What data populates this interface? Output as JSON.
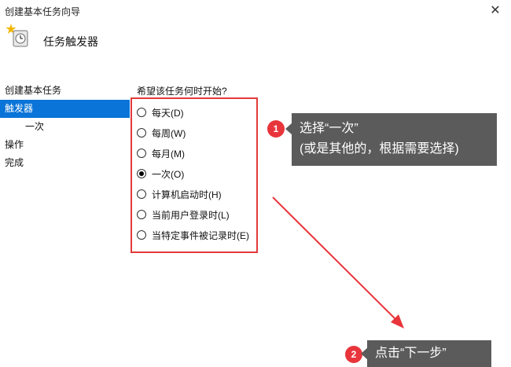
{
  "window": {
    "title": "创建基本任务向导",
    "close_glyph": "✕"
  },
  "header": {
    "icon": "task-clock-icon",
    "title": "任务触发器"
  },
  "sidebar": {
    "items": [
      {
        "label": "创建基本任务"
      },
      {
        "label": "触发器",
        "active": true
      },
      {
        "label": "一次"
      },
      {
        "label": "操作"
      },
      {
        "label": "完成"
      }
    ]
  },
  "main": {
    "question": "希望该任务何时开始?",
    "options": [
      {
        "label": "每天(D)",
        "checked": false
      },
      {
        "label": "每周(W)",
        "checked": false
      },
      {
        "label": "每月(M)",
        "checked": false
      },
      {
        "label": "一次(O)",
        "checked": true
      },
      {
        "label": "计算机启动时(H)",
        "checked": false
      },
      {
        "label": "当前用户登录时(L)",
        "checked": false
      },
      {
        "label": "当特定事件被记录时(E)",
        "checked": false
      }
    ]
  },
  "annotations": {
    "step1": {
      "number": "1",
      "line1": "选择“一次”",
      "line2": "(或是其他的，根据需要选择)"
    },
    "step2": {
      "number": "2",
      "text": "点击“下一步”"
    },
    "colors": {
      "highlight": "#e33a3a",
      "badge": "#e8353b",
      "callout": "#5b5b5b",
      "accent": "#0a74d8"
    }
  }
}
